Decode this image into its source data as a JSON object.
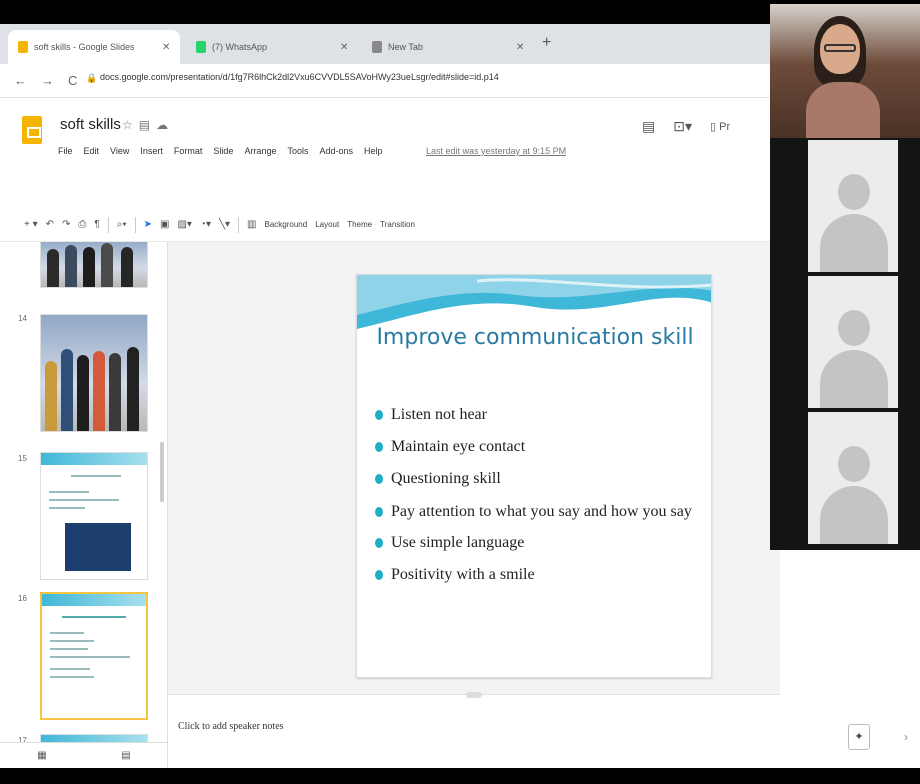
{
  "browser": {
    "tabs": [
      {
        "label": "soft skills - Google Slides",
        "favicon_color": "#f4b400"
      },
      {
        "label": "(7) WhatsApp",
        "favicon_color": "#25d366"
      },
      {
        "label": "New Tab",
        "favicon_color": "#888888"
      }
    ],
    "new_tab_icon": "+",
    "url": "docs.google.com/presentation/d/1fg7R6lhCk2dl2Vxu6CVVDL5SAVoHWy23ueLsgr/edit#slide=id.p14"
  },
  "slides_app": {
    "doc_title": "soft skills",
    "menu": [
      "File",
      "Edit",
      "View",
      "Insert",
      "Format",
      "Slide",
      "Arrange",
      "Tools",
      "Add-ons",
      "Help"
    ],
    "last_edit": "Last edit was yesterday at 9:15 PM",
    "present_label": "Pr",
    "toolbar_text": [
      "Background",
      "Layout",
      "Theme",
      "Transition"
    ]
  },
  "filmstrip": {
    "slides": [
      {
        "number": "",
        "kind": "people"
      },
      {
        "number": "14",
        "kind": "people"
      },
      {
        "number": "15",
        "kind": "slide"
      },
      {
        "number": "16",
        "kind": "slide",
        "selected": true
      },
      {
        "number": "17",
        "kind": "slide"
      }
    ]
  },
  "slide": {
    "title": "Improve communication skill",
    "bullets": [
      "Listen not hear",
      "Maintain eye contact",
      "Questioning skill",
      "Pay attention to what you say and how you say",
      "Use simple language",
      "Positivity with a smile"
    ],
    "accent_color": "#2a7aa5",
    "bullet_color": "#1db0c4"
  },
  "notes": {
    "placeholder": "Click to add speaker notes"
  },
  "video_call": {
    "tiles": [
      "presenter",
      "participant",
      "participant",
      "participant"
    ]
  }
}
